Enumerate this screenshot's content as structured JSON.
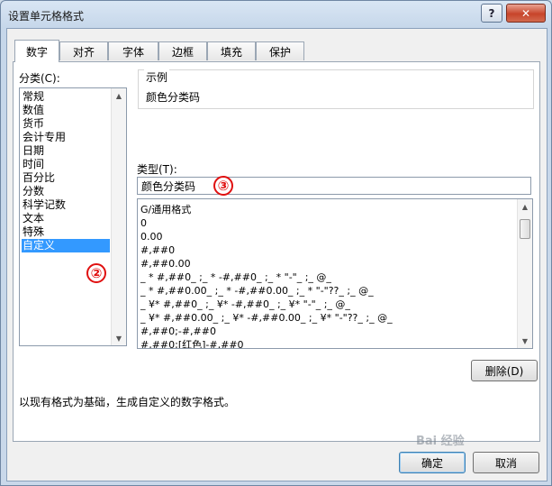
{
  "window": {
    "title": "设置单元格格式",
    "help_label": "?",
    "close_label": "✕"
  },
  "tabs": [
    {
      "label": "数字",
      "active": true
    },
    {
      "label": "对齐"
    },
    {
      "label": "字体"
    },
    {
      "label": "边框"
    },
    {
      "label": "填充"
    },
    {
      "label": "保护"
    }
  ],
  "category": {
    "label": "分类(C):",
    "items": [
      "常规",
      "数值",
      "货币",
      "会计专用",
      "日期",
      "时间",
      "百分比",
      "分数",
      "科学记数",
      "文本",
      "特殊",
      "自定义"
    ],
    "selected": "自定义"
  },
  "sample": {
    "label": "示例",
    "value": "颜色分类码"
  },
  "type": {
    "label": "类型(T):",
    "value": "颜色分类码",
    "formats": [
      "G/通用格式",
      "0",
      "0.00",
      "#,##0",
      "#,##0.00",
      "_ * #,##0_ ;_ * -#,##0_ ;_ * \"-\"_ ;_ @_",
      "_ * #,##0.00_ ;_ * -#,##0.00_ ;_ * \"-\"??_ ;_ @_",
      "_ ¥* #,##0_ ;_ ¥* -#,##0_ ;_ ¥* \"-\"_ ;_ @_",
      "_ ¥* #,##0.00_ ;_ ¥* -#,##0.00_ ;_ ¥* \"-\"??_ ;_ @_",
      "#,##0;-#,##0",
      "#,##0;[红色]-#,##0"
    ]
  },
  "buttons": {
    "delete": "删除(D)",
    "ok": "确定",
    "cancel": "取消"
  },
  "description": "以现有格式为基础，生成自定义的数字格式。",
  "annotations": {
    "marker2": "②",
    "marker3": "③"
  },
  "watermark": "Bai 经验"
}
